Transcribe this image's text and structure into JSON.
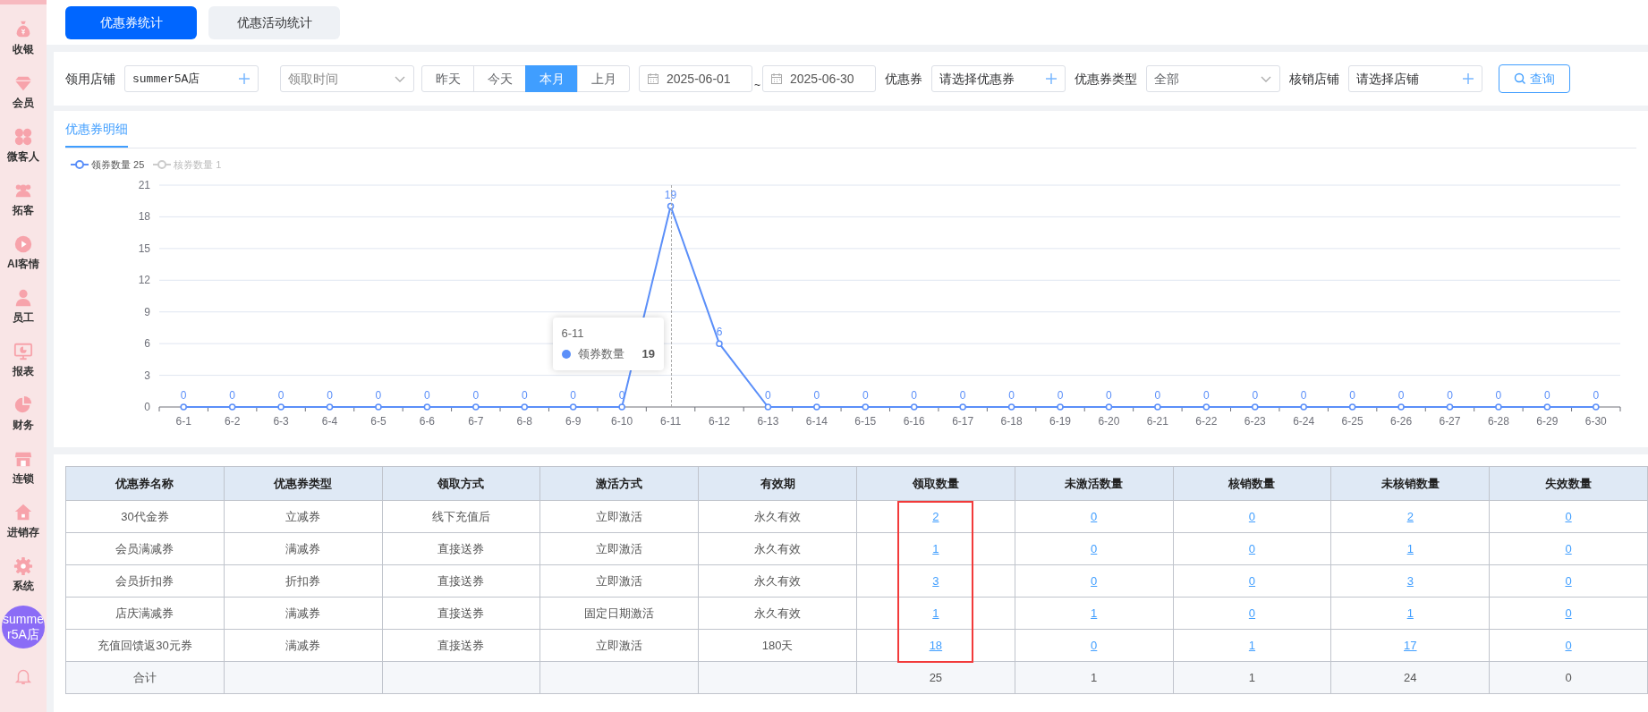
{
  "sidebar": {
    "items": [
      {
        "label": "收银",
        "kind": "bag"
      },
      {
        "label": "会员",
        "kind": "gem"
      },
      {
        "label": "微客人",
        "kind": "clover"
      },
      {
        "label": "拓客",
        "kind": "people"
      },
      {
        "label": "AI客情",
        "kind": "play"
      },
      {
        "label": "员工",
        "kind": "person"
      },
      {
        "label": "报表",
        "kind": "monitor"
      },
      {
        "label": "财务",
        "kind": "pie"
      },
      {
        "label": "连锁",
        "kind": "store"
      },
      {
        "label": "进销存",
        "kind": "house"
      },
      {
        "label": "系统",
        "kind": "gear"
      }
    ],
    "avatar": "summer5A店"
  },
  "tabs": [
    {
      "label": "优惠券统计",
      "selected": true
    },
    {
      "label": "优惠活动统计",
      "selected": false
    }
  ],
  "filters": [
    {
      "kind": "picker",
      "label": "领用店铺",
      "value": "summer5A店"
    },
    {
      "kind": "select",
      "placeholder": "领取时间"
    },
    {
      "kind": "segments",
      "options": [
        {
          "label": "昨天",
          "selected": false
        },
        {
          "label": "今天",
          "selected": false
        },
        {
          "label": "本月",
          "selected": true
        },
        {
          "label": "上月",
          "selected": false
        }
      ]
    },
    {
      "kind": "daterange",
      "start": "2025-06-01",
      "separator": "~",
      "end": "2025-06-30"
    },
    {
      "kind": "picker",
      "label": "优惠券",
      "placeholder": "请选择优惠券"
    },
    {
      "kind": "select",
      "label": "优惠券类型",
      "value": "全部"
    },
    {
      "kind": "picker",
      "label": "核销店铺",
      "placeholder": "请选择店铺"
    }
  ],
  "query_button": "查询",
  "detail": {
    "tab": {
      "label": "优惠券明细",
      "selected": true
    },
    "legend": [
      {
        "label": "领券数量 25",
        "on": true
      },
      {
        "label": "核券数量 1",
        "on": false
      }
    ],
    "tooltip": {
      "title": "6-11",
      "value": "19"
    },
    "chart_data": {
      "type": "line",
      "categories": [
        "6-1",
        "6-2",
        "6-3",
        "6-4",
        "6-5",
        "6-6",
        "6-7",
        "6-8",
        "6-9",
        "6-10",
        "6-11",
        "6-12",
        "6-13",
        "6-14",
        "6-15",
        "6-16",
        "6-17",
        "6-18",
        "6-19",
        "6-20",
        "6-21",
        "6-22",
        "6-23",
        "6-24",
        "6-25",
        "6-26",
        "6-27",
        "6-28",
        "6-29",
        "6-30"
      ],
      "series": [
        {
          "name": "领券数量",
          "color": "#5b8ff9",
          "marker": true,
          "values": [
            0,
            0,
            0,
            0,
            0,
            0,
            0,
            0,
            0,
            0,
            19,
            6,
            0,
            0,
            0,
            0,
            0,
            0,
            0,
            0,
            0,
            0,
            0,
            0,
            0,
            0,
            0,
            0,
            0,
            0
          ]
        }
      ],
      "ylim": [
        0,
        21
      ],
      "yticks": [
        0,
        3,
        6,
        9,
        12,
        15,
        18,
        21
      ],
      "grid": true,
      "data_labels": true
    }
  },
  "table": {
    "columns": [
      {
        "label": "优惠券名称",
        "kind": "text",
        "highlighted": false
      },
      {
        "label": "优惠券类型",
        "kind": "text",
        "highlighted": false
      },
      {
        "label": "领取方式",
        "kind": "text",
        "highlighted": false
      },
      {
        "label": "激活方式",
        "kind": "text",
        "highlighted": false
      },
      {
        "label": "有效期",
        "kind": "text",
        "highlighted": false
      },
      {
        "label": "领取数量",
        "kind": "link",
        "highlighted": true
      },
      {
        "label": "未激活数量",
        "kind": "link",
        "highlighted": false
      },
      {
        "label": "核销数量",
        "kind": "link",
        "highlighted": false
      },
      {
        "label": "未核销数量",
        "kind": "link",
        "highlighted": false
      },
      {
        "label": "失效数量",
        "kind": "link",
        "highlighted": false
      }
    ],
    "rows": [
      [
        "30代金券",
        "立减券",
        "线下充值后",
        "立即激活",
        "永久有效",
        "2",
        "0",
        "0",
        "2",
        "0"
      ],
      [
        "会员满减券",
        "满减券",
        "直接送券",
        "立即激活",
        "永久有效",
        "1",
        "0",
        "0",
        "1",
        "0"
      ],
      [
        "会员折扣券",
        "折扣券",
        "直接送券",
        "立即激活",
        "永久有效",
        "3",
        "0",
        "0",
        "3",
        "0"
      ],
      [
        "店庆满减券",
        "满减券",
        "直接送券",
        "固定日期激活",
        "永久有效",
        "1",
        "1",
        "0",
        "1",
        "0"
      ],
      [
        "充值回馈返30元券",
        "满减券",
        "直接送券",
        "立即激活",
        "180天",
        "18",
        "0",
        "1",
        "17",
        "0"
      ]
    ],
    "footer": {
      "label": "合计",
      "totals": [
        "25",
        "1",
        "1",
        "24",
        "0"
      ]
    }
  }
}
